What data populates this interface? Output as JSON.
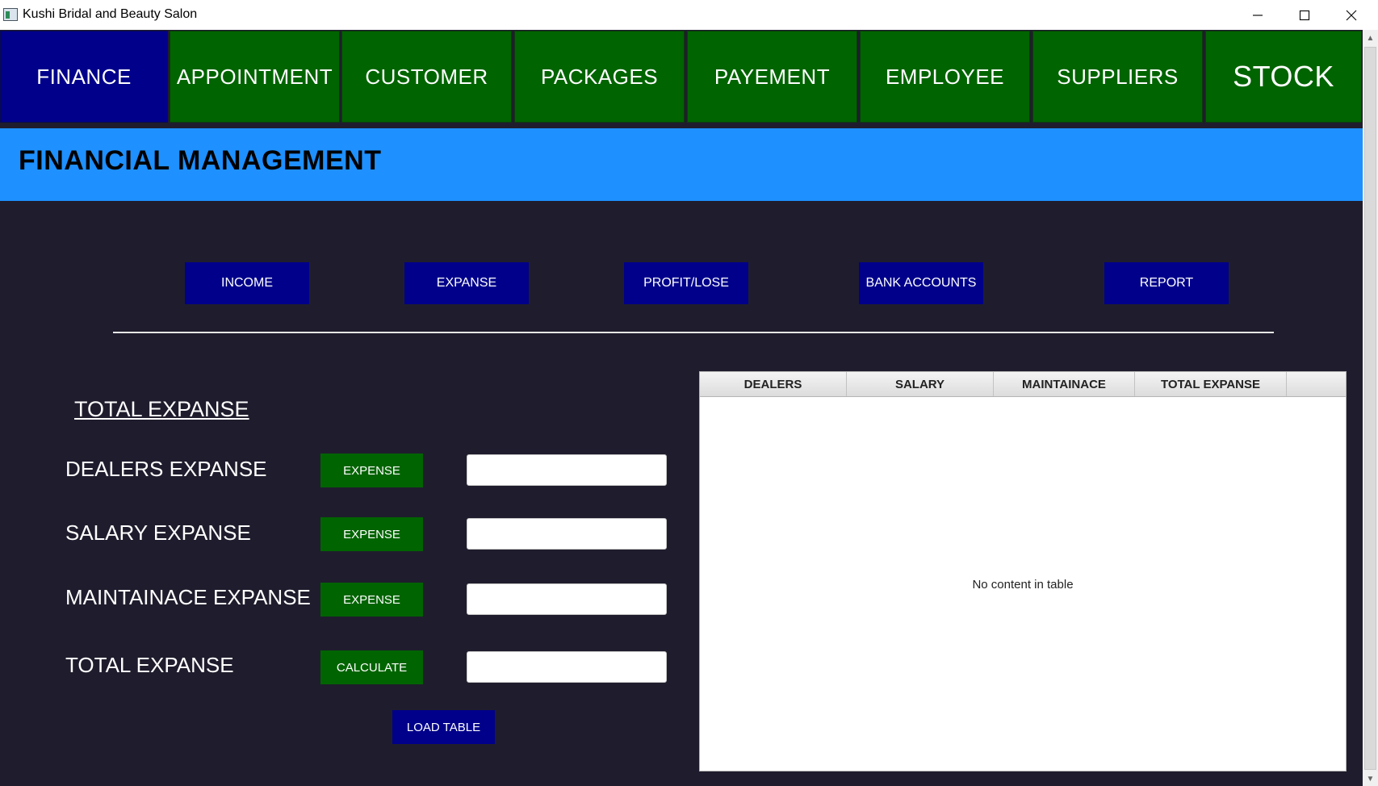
{
  "window": {
    "title": "Kushi Bridal and Beauty Salon",
    "icons": [
      "minimize-icon",
      "maximize-icon",
      "close-icon"
    ]
  },
  "nav": [
    {
      "label": "FINANCE",
      "active": true
    },
    {
      "label": "APPOINTMENT",
      "active": false
    },
    {
      "label": "CUSTOMER",
      "active": false
    },
    {
      "label": "PACKAGES",
      "active": false
    },
    {
      "label": "PAYEMENT",
      "active": false
    },
    {
      "label": "EMPLOYEE",
      "active": false
    },
    {
      "label": "SUPPLIERS",
      "active": false
    },
    {
      "label": "STOCK",
      "active": false
    }
  ],
  "header": {
    "title": "FINANCIAL MANAGEMENT"
  },
  "subnav": [
    "INCOME",
    "EXPANSE",
    "PROFIT/LOSE",
    "BANK ACCOUNTS",
    "REPORT"
  ],
  "form": {
    "title": "TOTAL EXPANSE",
    "rows": [
      {
        "label": "DEALERS EXPANSE",
        "button": "EXPENSE",
        "value": ""
      },
      {
        "label": "SALARY EXPANSE",
        "button": "EXPENSE",
        "value": ""
      },
      {
        "label": "MAINTAINACE EXPANSE",
        "button": "EXPENSE",
        "value": ""
      },
      {
        "label": "TOTAL EXPANSE",
        "button": "CALCULATE",
        "value": ""
      }
    ],
    "load_button": "LOAD TABLE"
  },
  "table": {
    "columns": [
      "DEALERS",
      "SALARY",
      "MAINTAINACE",
      "TOTAL EXPANSE"
    ],
    "rows": [],
    "empty_text": "No content in table"
  },
  "colors": {
    "nav_green": "#006400",
    "nav_active": "#00008b",
    "header_band": "#1e90ff",
    "background": "#1f1d2d",
    "button_blue": "#00008b",
    "button_green": "#006400"
  }
}
